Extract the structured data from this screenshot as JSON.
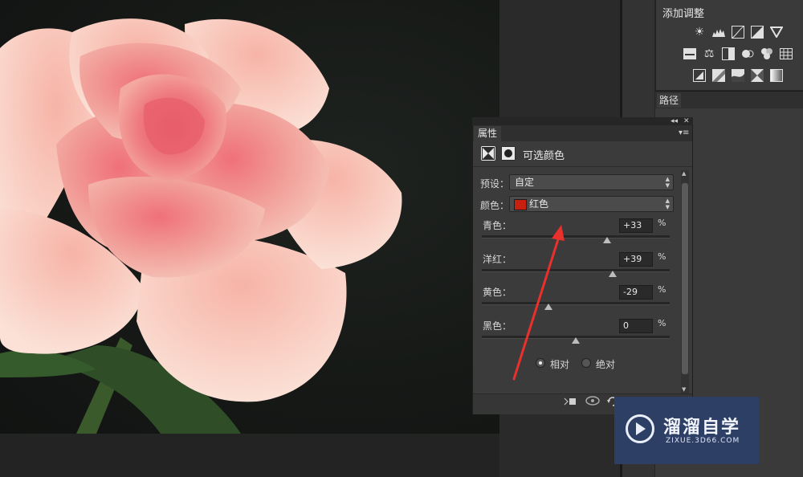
{
  "adjustments_panel": {
    "title": "添加调整",
    "icon_rows": [
      [
        "brightness-contrast-icon",
        "levels-icon",
        "curves-icon",
        "exposure-icon",
        "triangle-icon"
      ],
      [
        "vibrance-icon",
        "color-balance-icon",
        "black-white-icon",
        "photo-filter-icon",
        "channel-mixer-icon",
        "color-lookup-icon"
      ],
      [
        "invert-icon",
        "posterize-icon",
        "threshold-icon",
        "selective-color-icon",
        "gradient-map-icon"
      ]
    ]
  },
  "paths_panel": {
    "tab_label": "路径"
  },
  "properties_panel": {
    "tab_label": "属性",
    "collapse_glyph": "◂◂",
    "close_glyph": "✕",
    "menu_glyph": "▾≡",
    "header_title": "可选颜色",
    "preset_label": "预设：",
    "preset_value": "自定",
    "colors_label": "颜色：",
    "colors_value": "红色",
    "sliders": [
      {
        "label": "青色：",
        "value": "+33",
        "percent": 33
      },
      {
        "label": "洋红：",
        "value": "+39",
        "percent": 39
      },
      {
        "label": "黄色：",
        "value": "-29",
        "percent": -29
      },
      {
        "label": "黑色：",
        "value": "0",
        "percent": 0
      }
    ],
    "percent_sign": "%",
    "method_options": [
      {
        "label": "相对",
        "selected": true
      },
      {
        "label": "绝对",
        "selected": false
      }
    ]
  },
  "watermark": {
    "title": "溜溜自学",
    "subtitle": "ZIXUE.3D66.COM"
  },
  "colors": {
    "annotation_arrow": "#e8302c",
    "red_swatch": "#c8200e",
    "watermark_bg": "#2e3f66"
  }
}
